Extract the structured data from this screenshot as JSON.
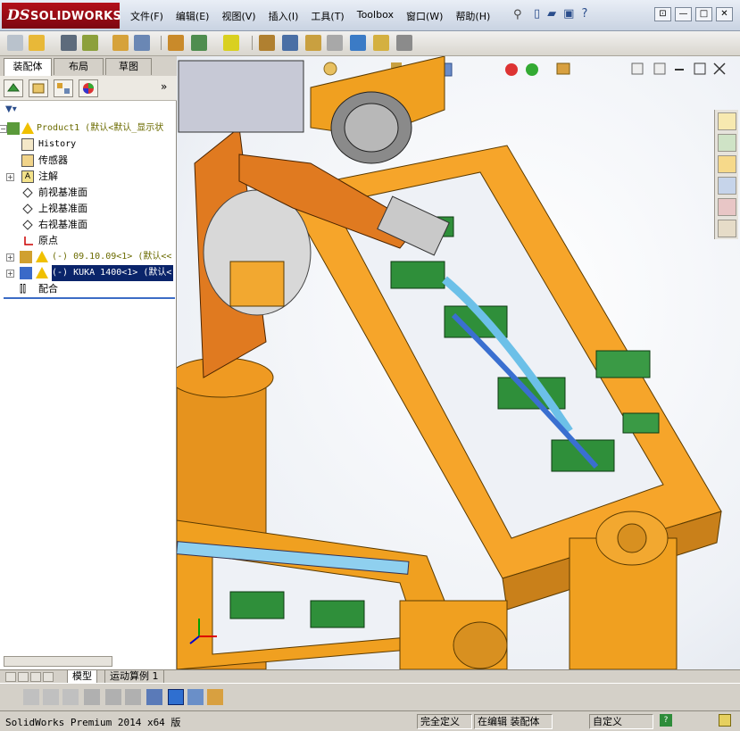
{
  "app": {
    "brand": "SOLIDWORKS",
    "ds_mark": "DS"
  },
  "menu": [
    "文件(F)",
    "编辑(E)",
    "视图(V)",
    "插入(I)",
    "工具(T)",
    "Toolbox",
    "窗口(W)",
    "帮助(H)"
  ],
  "window_buttons": [
    "⊡",
    "—",
    "□",
    "✕"
  ],
  "left_tabs": [
    "装配体",
    "布局",
    "草图"
  ],
  "tree": [
    {
      "label": "Product1  (默认<默认_显示状",
      "icon": "assembly-icon",
      "warn": true,
      "expander": "−"
    },
    {
      "label": "History",
      "icon": "history-icon"
    },
    {
      "label": "传感器",
      "icon": "sensor-icon"
    },
    {
      "label": "注解",
      "icon": "annotation-icon",
      "expander": "+"
    },
    {
      "label": "前视基准面",
      "icon": "plane-icon"
    },
    {
      "label": "上视基准面",
      "icon": "plane-icon"
    },
    {
      "label": "右视基准面",
      "icon": "plane-icon"
    },
    {
      "label": "原点",
      "icon": "origin-icon"
    },
    {
      "label": "(-) 09.10.09<1>  (默认<<",
      "icon": "part-icon",
      "warn": true,
      "expander": "+"
    },
    {
      "label": "(-) KUKA 1400<1>  (默认<",
      "icon": "part-icon",
      "warn": true,
      "expander": "+",
      "selected": true
    },
    {
      "label": "配合",
      "icon": "mates-icon"
    }
  ],
  "bottom_tabs": [
    "模型",
    "运动算例 1"
  ],
  "status": {
    "app": "SolidWorks Premium 2014 x64 版",
    "constraint": "完全定义",
    "mode": "在编辑 装配体",
    "units": "自定义"
  },
  "colors": {
    "frame": "#f0a020",
    "robot": "#e07a20",
    "viewport_bg": "#eef1f6",
    "selection": "#0a246a"
  }
}
